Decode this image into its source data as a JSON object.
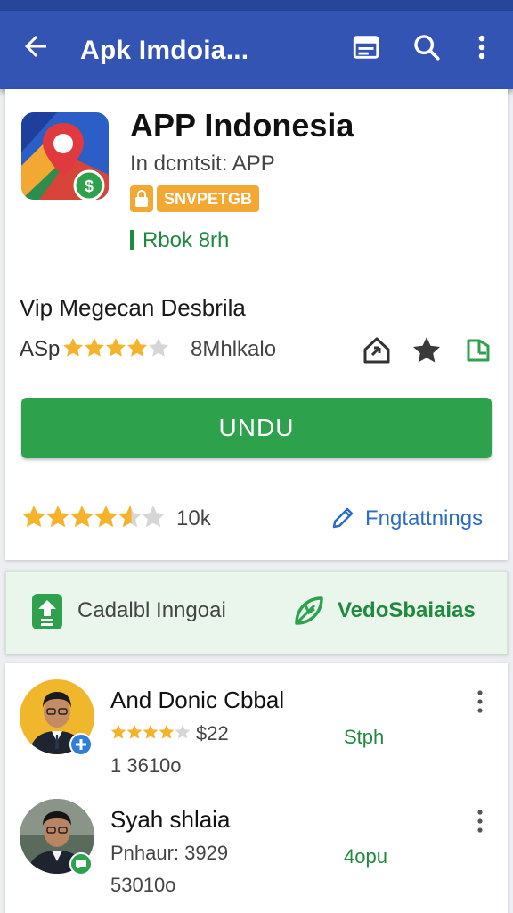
{
  "appbar": {
    "title": "Apk Imdoia...",
    "icons": [
      "back-arrow-icon",
      "list-icon",
      "search-icon",
      "more-vert-icon"
    ]
  },
  "app": {
    "title": "APP Indonesia",
    "subtitle": "In dcmtsit: APP",
    "badge": "SNVPETGB",
    "developer_link": "Rbok 8rh"
  },
  "details": {
    "section_title": "Vip Megecan Desbrila",
    "rating_label": "ASp",
    "rating_stars": 4,
    "count_text": "8Mhlkalo",
    "action_icons": [
      "share-icon",
      "star-icon",
      "bookmark-icon"
    ]
  },
  "install_label": "UNDU",
  "rating": {
    "stars": 4.5,
    "count": "10k",
    "link_label": "Fngtattnings"
  },
  "info": {
    "left_label": "Cadalbl Inngoai",
    "right_label": "VedoSbaiaias"
  },
  "reviews": [
    {
      "name": "And Donic Cbbal",
      "stars": 4,
      "price": "$22",
      "tag": "Stph",
      "meta": "1 3610o",
      "badge_color": "#2f7fd8"
    },
    {
      "name": "Syah shlaia",
      "line2": "Pnhaur: 3929",
      "tag": "4opu",
      "meta": "53010o",
      "badge_color": "#2ea14c"
    }
  ],
  "colors": {
    "appbar": "#3454b4",
    "accent_green": "#2ea14c",
    "star": "#f4b32a",
    "link_blue": "#2c6cc4"
  }
}
